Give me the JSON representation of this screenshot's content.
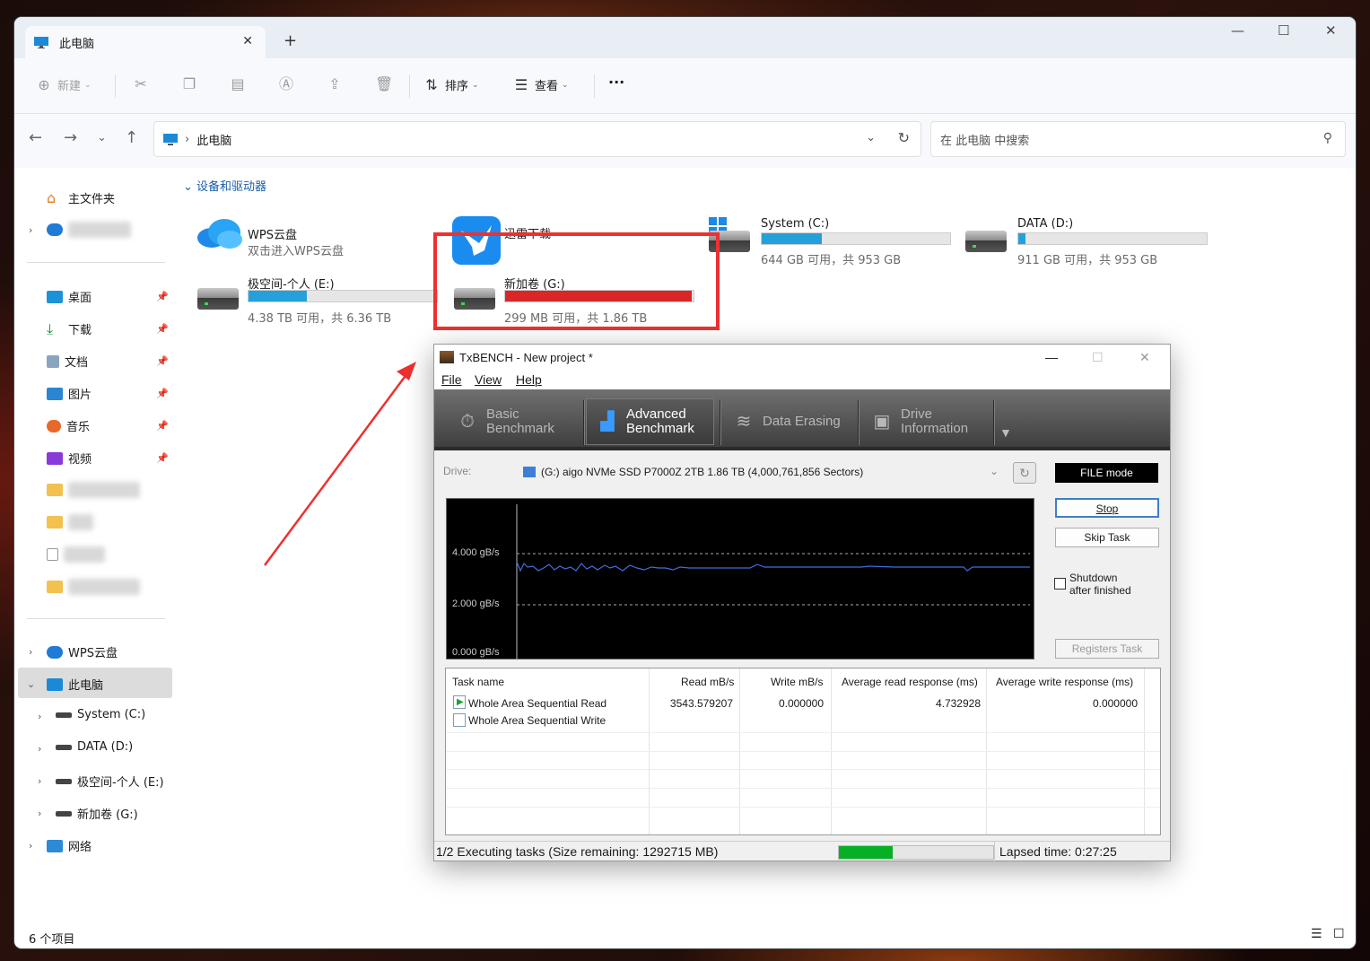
{
  "explorer": {
    "tab_title": "此电脑",
    "toolbar": {
      "new_label": "新建",
      "sort_label": "排序",
      "view_label": "查看",
      "more_label": "···"
    },
    "address": {
      "path": "此电脑",
      "search_placeholder": "在 此电脑 中搜索"
    },
    "sidebar": {
      "home": "主文件夹",
      "quick": [
        {
          "label": "桌面"
        },
        {
          "label": "下载"
        },
        {
          "label": "文档"
        },
        {
          "label": "图片"
        },
        {
          "label": "音乐"
        },
        {
          "label": "视频"
        }
      ],
      "wps": "WPS云盘",
      "this_pc": "此电脑",
      "drives": [
        {
          "label": "System (C:)"
        },
        {
          "label": "DATA (D:)"
        },
        {
          "label": "极空间-个人 (E:)"
        },
        {
          "label": "新加卷 (G:)"
        }
      ],
      "network": "网络"
    },
    "group_label": "设备和驱动器",
    "items": {
      "wps": {
        "name": "WPS云盘",
        "sub": "双击进入WPS云盘"
      },
      "xunlei": {
        "name": "迅雷下载"
      },
      "c": {
        "name": "System (C:)",
        "sub": "644 GB 可用，共 953 GB",
        "used_fraction": 0.32
      },
      "d": {
        "name": "DATA (D:)",
        "sub": "911 GB 可用，共 953 GB",
        "used_fraction": 0.04
      },
      "e": {
        "name": "极空间-个人 (E:)",
        "sub": "4.38 TB 可用，共 6.36 TB",
        "used_fraction": 0.31
      },
      "g": {
        "name": "新加卷 (G:)",
        "sub": "299 MB 可用，共 1.86 TB",
        "used_fraction": 0.99
      }
    },
    "status": "6 个项目",
    "colors": {
      "bar_normal": "#26a0da",
      "bar_full": "#da2626",
      "annotation": "#ee3030"
    }
  },
  "txbench": {
    "title": "TxBENCH - New project *",
    "menu": [
      "File",
      "View",
      "Help"
    ],
    "tabs": [
      {
        "line1": "Basic",
        "line2": "Benchmark"
      },
      {
        "line1": "Advanced",
        "line2": "Benchmark"
      },
      {
        "line1": "Data Erasing",
        "line2": ""
      },
      {
        "line1": "Drive",
        "line2": "Information"
      }
    ],
    "drive_label": "Drive:",
    "drive_value": "(G:) aigo NVMe SSD P7000Z 2TB  1.86 TB (4,000,761,856 Sectors)",
    "file_mode": "FILE mode",
    "stop_label": "Stop",
    "skip_label": "Skip Task",
    "shutdown_line1": "Shutdown",
    "shutdown_line2": "after finished",
    "registers_label": "Registers Task",
    "graph_labels": [
      "4.000 gB/s",
      "2.000 gB/s",
      "0.000 gB/s"
    ],
    "columns": [
      "Task name",
      "Read mB/s",
      "Write mB/s",
      "Average read response (ms)",
      "Average write response (ms)"
    ],
    "rows": [
      {
        "name": "Whole Area Sequential Read",
        "read": "3543.579207",
        "write": "0.000000",
        "avg_read": "4.732928",
        "avg_write": "0.000000"
      },
      {
        "name": "Whole Area Sequential Write",
        "read": "",
        "write": "",
        "avg_read": "",
        "avg_write": ""
      }
    ],
    "status_text": "1/2 Executing tasks (Size remaining: 1292715 MB)",
    "progress_fraction": 0.35,
    "lapsed": "Lapsed time: 0:27:25"
  }
}
